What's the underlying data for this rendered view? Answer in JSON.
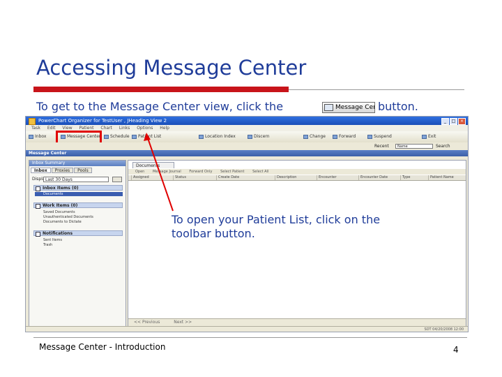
{
  "slide": {
    "title": "Accessing Message Center",
    "instruction_before": "To get to the Message Center view, click the",
    "instruction_button": "Message Center",
    "instruction_after": "button.",
    "callout": "To open your Patient List, click on the toolbar button.",
    "footer": "Message Center - Introduction",
    "page_number": "4"
  },
  "app": {
    "window_title": "PowerChart Organizer for TestUser , JHeading View 2",
    "menu": [
      "Task",
      "Edit",
      "View",
      "Patient",
      "Chart",
      "Links",
      "Options",
      "Help"
    ],
    "toolbar": [
      {
        "label": "Inbox",
        "icon": "inbox-icon"
      },
      {
        "label": "Message Center",
        "icon": "message-center-icon"
      },
      {
        "label": "Schedule",
        "icon": "calendar-icon"
      },
      {
        "label": "Patient List",
        "icon": "patient-list-icon"
      },
      {
        "label": "Location Index",
        "icon": "location-icon"
      },
      {
        "label": "Discern",
        "icon": "discern-icon"
      },
      {
        "label": "Change",
        "icon": "change-icon"
      },
      {
        "label": "Forward",
        "icon": "forward-icon"
      },
      {
        "label": "Suspend",
        "icon": "suspend-icon"
      },
      {
        "label": "Exit",
        "icon": "exit-icon"
      }
    ],
    "recent_label": "Recent",
    "name_placeholder": "Name",
    "search_label": "Search",
    "view_title": "Message Center",
    "left_panel": {
      "header": "Inbox Summary",
      "tabs": [
        "Inbox",
        "Proxies",
        "Pools"
      ],
      "display_label": "Display:",
      "display_value": "Last 30 Days",
      "sections": [
        {
          "title": "Inbox Items (0)",
          "items": [
            "Documents"
          ]
        },
        {
          "title": "Work Items (0)",
          "items": [
            "Saved Documents",
            "Unauthenticated Documents",
            "Documents to Dictate"
          ]
        },
        {
          "title": "Notifications",
          "items": [
            "Sent Items",
            "Trash"
          ]
        }
      ]
    },
    "right_panel": {
      "tab": "Documents",
      "toolbar": [
        "Open",
        "Message Journal",
        "Forward Only",
        "Select Patient",
        "Select All"
      ],
      "columns": [
        "Assigned",
        "Status",
        "Create Date",
        "Description",
        "Encounter",
        "Encounter Date",
        "Type",
        "Patient Name"
      ],
      "prev": "<< Previous",
      "next": "Next >>"
    },
    "status_right": "SDT  04/20/2008  12:00"
  },
  "colors": {
    "title": "#1f3c99",
    "accent_red": "#c8141a",
    "highlight_box": "#e00000",
    "pointer": "#e00000"
  }
}
